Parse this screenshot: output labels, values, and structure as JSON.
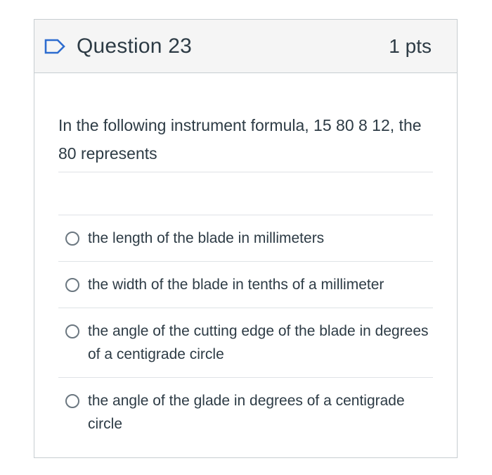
{
  "question": {
    "title": "Question 23",
    "points": "1 pts",
    "text": "In the following instrument formula, 15 80 8 12, the 80 represents",
    "flag_icon": "flag-outline-icon",
    "accent_color": "#2d6ccf"
  },
  "answers": [
    {
      "label": "the length of the blade in millimeters"
    },
    {
      "label": "the width of the blade in tenths of a millimeter"
    },
    {
      "label": "the angle of the cutting edge of the blade in degrees of a centigrade circle"
    },
    {
      "label": "the angle of the glade in degrees of a centigrade circle"
    }
  ]
}
